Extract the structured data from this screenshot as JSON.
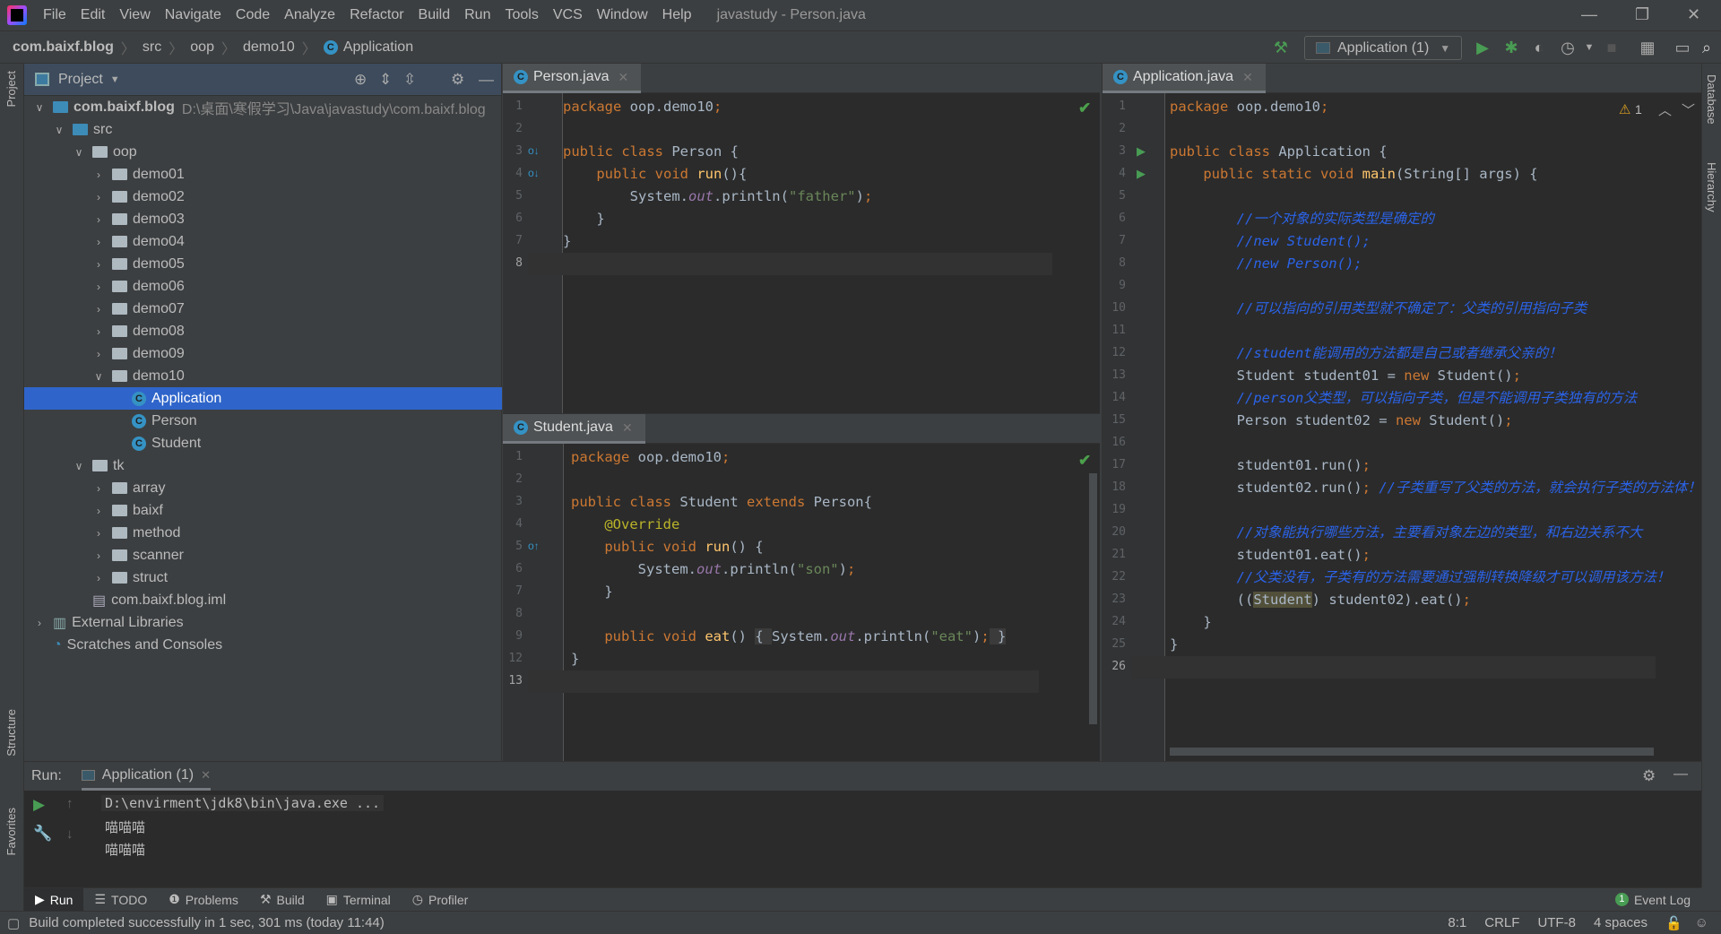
{
  "menu": {
    "items": [
      "File",
      "Edit",
      "View",
      "Navigate",
      "Code",
      "Analyze",
      "Refactor",
      "Build",
      "Run",
      "Tools",
      "VCS",
      "Window",
      "Help"
    ],
    "window_title": "javastudy - Person.java"
  },
  "breadcrumb": [
    "com.baixf.blog",
    "src",
    "oop",
    "demo10",
    "Application"
  ],
  "run_config": "Application (1)",
  "project": {
    "title": "Project",
    "tree": [
      {
        "label": "com.baixf.blog",
        "extra": "D:\\桌面\\寒假学习\\Java\\javastudy\\com.baixf.blog",
        "level": 0,
        "type": "module",
        "open": true
      },
      {
        "label": "src",
        "level": 1,
        "type": "src",
        "open": true
      },
      {
        "label": "oop",
        "level": 2,
        "type": "folder",
        "open": true
      },
      {
        "label": "demo01",
        "level": 3,
        "type": "folder"
      },
      {
        "label": "demo02",
        "level": 3,
        "type": "folder"
      },
      {
        "label": "demo03",
        "level": 3,
        "type": "folder"
      },
      {
        "label": "demo04",
        "level": 3,
        "type": "folder"
      },
      {
        "label": "demo05",
        "level": 3,
        "type": "folder"
      },
      {
        "label": "demo06",
        "level": 3,
        "type": "folder"
      },
      {
        "label": "demo07",
        "level": 3,
        "type": "folder"
      },
      {
        "label": "demo08",
        "level": 3,
        "type": "folder"
      },
      {
        "label": "demo09",
        "level": 3,
        "type": "folder"
      },
      {
        "label": "demo10",
        "level": 3,
        "type": "folder",
        "open": true
      },
      {
        "label": "Application",
        "level": 4,
        "type": "class",
        "selected": true
      },
      {
        "label": "Person",
        "level": 4,
        "type": "class"
      },
      {
        "label": "Student",
        "level": 4,
        "type": "class"
      },
      {
        "label": "tk",
        "level": 2,
        "type": "folder",
        "open": true
      },
      {
        "label": "array",
        "level": 3,
        "type": "folder"
      },
      {
        "label": "baixf",
        "level": 3,
        "type": "folder"
      },
      {
        "label": "method",
        "level": 3,
        "type": "folder"
      },
      {
        "label": "scanner",
        "level": 3,
        "type": "folder"
      },
      {
        "label": "struct",
        "level": 3,
        "type": "folder"
      },
      {
        "label": "com.baixf.blog.iml",
        "level": 2,
        "type": "file",
        "leaf": true
      },
      {
        "label": "External Libraries",
        "level": 0,
        "type": "lib"
      },
      {
        "label": "Scratches and Consoles",
        "level": 0,
        "type": "scratch",
        "leaf": true
      }
    ]
  },
  "editors": {
    "person": {
      "tab": "Person.java",
      "current_line": 8,
      "lines": [
        {
          "n": "1",
          "t": [
            [
              "package",
              "kw"
            ],
            [
              " oop.demo10",
              ""
            ],
            [
              ";",
              "kw"
            ]
          ]
        },
        {
          "n": "2",
          "t": []
        },
        {
          "n": "3",
          "t": [
            [
              "public class ",
              "kw"
            ],
            [
              "Person {",
              ""
            ]
          ]
        },
        {
          "n": "4",
          "t": [
            [
              "    public void ",
              "kw"
            ],
            [
              "run",
              "fn"
            ],
            [
              "(){",
              ""
            ]
          ]
        },
        {
          "n": "5",
          "t": [
            [
              "        System.",
              ""
            ],
            [
              "out",
              "fld"
            ],
            [
              ".println(",
              ""
            ],
            [
              "\"father\"",
              "str"
            ],
            [
              ")",
              ""
            ],
            [
              ";",
              "kw"
            ]
          ]
        },
        {
          "n": "6",
          "t": [
            [
              "    }",
              ""
            ]
          ]
        },
        {
          "n": "7",
          "t": [
            [
              "}",
              ""
            ]
          ]
        },
        {
          "n": "8",
          "t": []
        }
      ]
    },
    "student": {
      "tab": "Student.java",
      "current_line": "13",
      "lines": [
        {
          "n": "1",
          "t": [
            [
              "package",
              "kw"
            ],
            [
              " oop.demo10",
              ""
            ],
            [
              ";",
              "kw"
            ]
          ]
        },
        {
          "n": "2",
          "t": []
        },
        {
          "n": "3",
          "t": [
            [
              "public class ",
              "kw"
            ],
            [
              "Student ",
              ""
            ],
            [
              "extends ",
              "kw"
            ],
            [
              "Person{",
              ""
            ]
          ]
        },
        {
          "n": "4",
          "t": [
            [
              "    @Override",
              "ann"
            ]
          ]
        },
        {
          "n": "5",
          "t": [
            [
              "    public void ",
              "kw"
            ],
            [
              "run",
              "fn"
            ],
            [
              "() {",
              ""
            ]
          ]
        },
        {
          "n": "6",
          "t": [
            [
              "        System.",
              ""
            ],
            [
              "out",
              "fld"
            ],
            [
              ".println(",
              ""
            ],
            [
              "\"son\"",
              "str"
            ],
            [
              ")",
              ""
            ],
            [
              ";",
              "kw"
            ]
          ]
        },
        {
          "n": "7",
          "t": [
            [
              "    }",
              ""
            ]
          ]
        },
        {
          "n": "8",
          "t": []
        },
        {
          "n": "9",
          "t": [
            [
              "    public void ",
              "kw"
            ],
            [
              "eat",
              "fn"
            ],
            [
              "() ",
              ""
            ],
            [
              "{ ",
              "fold"
            ],
            [
              "System.",
              ""
            ],
            [
              "out",
              "fld"
            ],
            [
              ".println(",
              ""
            ],
            [
              "\"eat\"",
              "str"
            ],
            [
              ")",
              ""
            ],
            [
              ";",
              "kw"
            ],
            [
              " }",
              "fold"
            ]
          ]
        },
        {
          "n": "12",
          "t": [
            [
              "}",
              ""
            ]
          ]
        },
        {
          "n": "13",
          "t": []
        }
      ]
    },
    "application": {
      "tab": "Application.java",
      "warnings": "1",
      "current_line": "26",
      "lines": [
        {
          "n": "1",
          "t": [
            [
              "package",
              "kw"
            ],
            [
              " oop.demo10",
              ""
            ],
            [
              ";",
              "kw"
            ]
          ]
        },
        {
          "n": "2",
          "t": []
        },
        {
          "n": "3",
          "t": [
            [
              "public class ",
              "kw"
            ],
            [
              "Application {",
              ""
            ]
          ]
        },
        {
          "n": "4",
          "t": [
            [
              "    public static void ",
              "kw"
            ],
            [
              "main",
              "fn"
            ],
            [
              "(String[] args) {",
              ""
            ]
          ]
        },
        {
          "n": "5",
          "t": []
        },
        {
          "n": "6",
          "t": [
            [
              "        //一个对象的实际类型是确定的",
              "cm"
            ]
          ]
        },
        {
          "n": "7",
          "t": [
            [
              "        //new Student();",
              "cm"
            ]
          ]
        },
        {
          "n": "8",
          "t": [
            [
              "        //new Person();",
              "cm"
            ]
          ]
        },
        {
          "n": "9",
          "t": []
        },
        {
          "n": "10",
          "t": [
            [
              "        //可以指向的引用类型就不确定了：父类的引用指向子类",
              "cm"
            ]
          ]
        },
        {
          "n": "11",
          "t": []
        },
        {
          "n": "12",
          "t": [
            [
              "        //student能调用的方法都是自己或者继承父亲的！",
              "cm"
            ]
          ]
        },
        {
          "n": "13",
          "t": [
            [
              "        Student student01 = ",
              ""
            ],
            [
              "new ",
              "kw"
            ],
            [
              "Student()",
              ""
            ],
            [
              ";",
              "kw"
            ]
          ]
        },
        {
          "n": "14",
          "t": [
            [
              "        //person父类型，可以指向子类，但是不能调用子类独有的方法",
              "cm"
            ]
          ]
        },
        {
          "n": "15",
          "t": [
            [
              "        Person student02 = ",
              ""
            ],
            [
              "new ",
              "kw"
            ],
            [
              "Student()",
              ""
            ],
            [
              ";",
              "kw"
            ]
          ]
        },
        {
          "n": "16",
          "t": []
        },
        {
          "n": "17",
          "t": [
            [
              "        student01.run()",
              ""
            ],
            [
              ";",
              "kw"
            ]
          ]
        },
        {
          "n": "18",
          "t": [
            [
              "        student02.run()",
              ""
            ],
            [
              ";",
              "kw"
            ],
            [
              " //子类重写了父类的方法，就会执行子类的方法体！",
              "cm"
            ]
          ]
        },
        {
          "n": "19",
          "t": []
        },
        {
          "n": "20",
          "t": [
            [
              "        //对象能执行哪些方法，主要看对象左边的类型，和右边关系不大",
              "cm"
            ]
          ]
        },
        {
          "n": "21",
          "t": [
            [
              "        student01.eat()",
              ""
            ],
            [
              ";",
              "kw"
            ]
          ]
        },
        {
          "n": "22",
          "t": [
            [
              "        //父类没有，子类有的方法需要通过强制转换降级才可以调用该方法！",
              "cm"
            ]
          ]
        },
        {
          "n": "23",
          "t": [
            [
              "        ((",
              ""
            ],
            [
              "Student",
              "hl"
            ],
            [
              ") student02).eat()",
              ""
            ],
            [
              ";",
              "kw"
            ]
          ]
        },
        {
          "n": "24",
          "t": [
            [
              "    }",
              ""
            ]
          ]
        },
        {
          "n": "25",
          "t": [
            [
              "}",
              ""
            ]
          ]
        },
        {
          "n": "26",
          "t": []
        }
      ]
    }
  },
  "run": {
    "label": "Run:",
    "tab": "Application (1)",
    "output": [
      "D:\\envirment\\jdk8\\bin\\java.exe ...",
      "喵喵喵",
      "喵喵喵"
    ]
  },
  "tool_windows": [
    "Run",
    "TODO",
    "Problems",
    "Build",
    "Terminal",
    "Profiler"
  ],
  "event_log": "Event Log",
  "event_count": "1",
  "side": {
    "left_top": "Project",
    "left_mid": "Structure",
    "left_bottom": "Favorites",
    "right_top": "Database",
    "right_mid": "Hierarchy"
  },
  "status": {
    "message": "Build completed successfully in 1 sec, 301 ms (today 11:44)",
    "position": "8:1",
    "line_sep": "CRLF",
    "encoding": "UTF-8",
    "indent": "4 spaces"
  },
  "colors": {
    "keyword": "#cc7832",
    "string": "#6a8759",
    "comment": "#2b63e8",
    "selection": "#2f65ca",
    "run_green": "#499c54"
  }
}
